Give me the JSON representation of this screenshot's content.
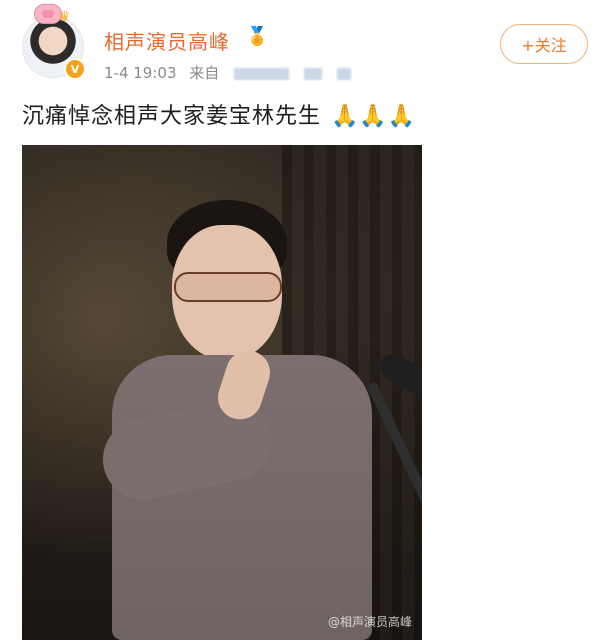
{
  "post": {
    "author_name": "相声演员高峰",
    "time": "1-4 19:03",
    "source_prefix": "来自",
    "text": "沉痛悼念相声大家姜宝林先生",
    "pray_emoji": "🙏🙏🙏",
    "follow_label": "+关注",
    "photo_watermark": "@相声演员高峰"
  },
  "icons": {
    "avatar_badge": "v-badge-icon",
    "pig_decoration": "pig-icon",
    "crown_decoration": "crown-icon",
    "medal": "medal-icon"
  },
  "colors": {
    "name_orange": "#e86a2b",
    "follow_border": "#f4b07d",
    "text_dark": "#1f1f1f",
    "meta_gray": "#8a8a8a"
  }
}
